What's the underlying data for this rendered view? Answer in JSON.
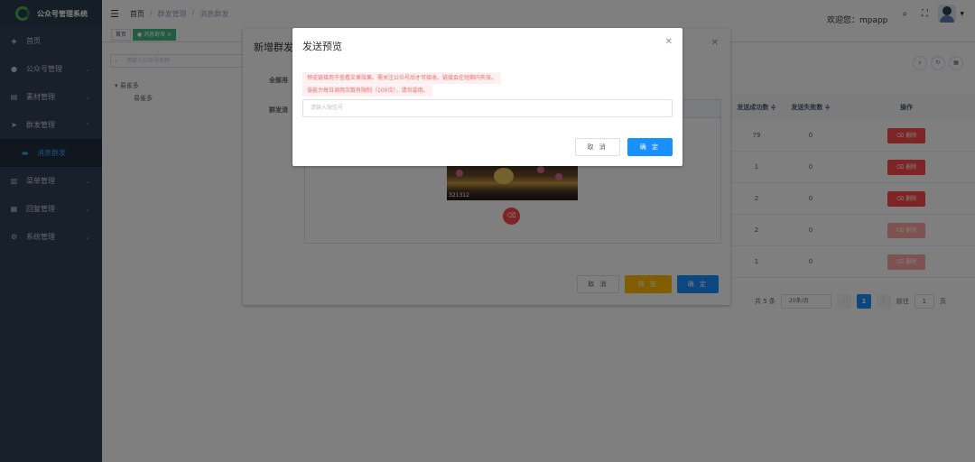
{
  "app": {
    "title": "公众号管理系统"
  },
  "sidebar": {
    "items": [
      {
        "label": "首页",
        "icon": "dashboard-icon",
        "glyph": "◈"
      },
      {
        "label": "公众号管理",
        "icon": "wechat-icon",
        "glyph": "●"
      },
      {
        "label": "素材管理",
        "icon": "document-icon",
        "glyph": "▤"
      },
      {
        "label": "群发管理",
        "icon": "send-icon",
        "glyph": "➤"
      },
      {
        "label": "消息群发",
        "icon": "message-icon",
        "glyph": "▬"
      },
      {
        "label": "菜单管理",
        "icon": "menu-icon",
        "glyph": "▥"
      },
      {
        "label": "回复管理",
        "icon": "reply-icon",
        "glyph": "▦"
      },
      {
        "label": "系统管理",
        "icon": "gear-icon",
        "glyph": "⚙"
      }
    ]
  },
  "header": {
    "breadcrumb": [
      "首页",
      "群发管理",
      "消息群发"
    ],
    "separator": "/",
    "welcome": "欢迎您：mpapp"
  },
  "tags": {
    "home": "首页",
    "current": "● 消息群发 ×"
  },
  "tree": {
    "search_placeholder": "请输入公众号名称",
    "root": "易雀多",
    "child": "易雀多"
  },
  "table": {
    "headers": [
      "发送成功数 ≑",
      "发送失败数 ≑",
      "操作"
    ],
    "rows": [
      {
        "success": "79",
        "fail": "0",
        "action": "删除"
      },
      {
        "success": "1",
        "fail": "0",
        "action": "删除"
      },
      {
        "success": "2",
        "fail": "0",
        "action": "删除"
      },
      {
        "success": "2",
        "fail": "0",
        "action": "删除"
      },
      {
        "success": "1",
        "fail": "0",
        "action": "删除"
      }
    ]
  },
  "pagination": {
    "total": "共 5 条",
    "page_size": "20条/页",
    "current": "1",
    "goto": "前往",
    "goto_value": "1",
    "page_unit": "页"
  },
  "dialog_new": {
    "title": "新增群发",
    "label_all": "全部用",
    "label_send": "群发消",
    "image_caption": "321312",
    "cancel": "取 消",
    "preview": "预 览",
    "confirm": "确 定"
  },
  "dialog_preview": {
    "title": "发送预览",
    "alert1": "预览链接用于查看文章效果。需关注公众号后才可接收。链接会在短期内失效。",
    "alert2": "该能力每日调用次数有限制（100次），请勿滥用。",
    "input_placeholder": "请输入微信号",
    "cancel": "取 消",
    "confirm": "确 定"
  },
  "colors": {
    "sidebar": "#304156",
    "primary": "#1890ff",
    "danger": "#ff4949",
    "warning": "#ffba00"
  }
}
